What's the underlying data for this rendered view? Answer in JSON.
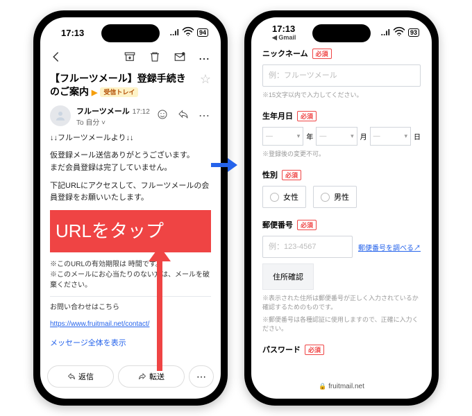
{
  "status": {
    "time": "17:13",
    "back_gmail": "◀ Gmail",
    "signal": "..ıl",
    "wifi": "⌃",
    "battery_left": "94",
    "battery_right": "93"
  },
  "gmail": {
    "subject": "【フルーツメール】登録手続きのご案内",
    "inbox_label": "受信トレイ",
    "sender_name": "フルーツメール",
    "sender_time": "17:12",
    "sender_to": "To 自分 ˅",
    "body": {
      "greeting": "↓↓フルーツメールより↓↓",
      "p1": "仮登録メール送信ありがとうございます。",
      "p2": "まだ会員登録は完了していません。",
      "p3": "下記URLにアクセスして、フルーツメールの会員登録をお願いいたします。",
      "highlight": "URLをタップ",
      "note1": "※このURLの有効期限は     時間です。",
      "note2": "※このメールにお心当たりのない方は、メールを破棄ください。",
      "contact_label": "お問い合わせはこちら",
      "contact_url": "https://www.fruitmail.net/contact/",
      "show_all": "メッセージ全体を表示"
    },
    "actions": {
      "reply": "返信",
      "forward": "転送"
    }
  },
  "form": {
    "nickname": {
      "label": "ニックネーム",
      "req": "必須",
      "placeholder": "例：フルーツメール",
      "hint": "※15文字以内で入力してください。"
    },
    "birth": {
      "label": "生年月日",
      "req": "必須",
      "dash": "—",
      "year": "年",
      "month": "月",
      "day": "日",
      "hint": "※登録後の変更不可。"
    },
    "gender": {
      "label": "性別",
      "req": "必須",
      "female": "女性",
      "male": "男性"
    },
    "zip": {
      "label": "郵便番号",
      "req": "必須",
      "placeholder": "例：123-4567",
      "lookup": "郵便番号を調べる",
      "addr_btn": "住所確認",
      "hint1": "※表示された住所は郵便番号が正しく入力されているか確認するためのものです。",
      "hint2": "※郵便番号は各種認証に使用しますので、正確に入力ください。"
    },
    "password": {
      "label": "パスワード",
      "req": "必須"
    },
    "url_bar": "fruitmail.net"
  },
  "icons": {
    "back": "back-icon",
    "archive": "archive-icon",
    "trash": "trash-icon",
    "unread": "mark-unread-icon",
    "more": "more-icon",
    "star": "star-icon",
    "smile": "smile-icon",
    "reply_small": "reply-icon",
    "ext": "↗"
  }
}
